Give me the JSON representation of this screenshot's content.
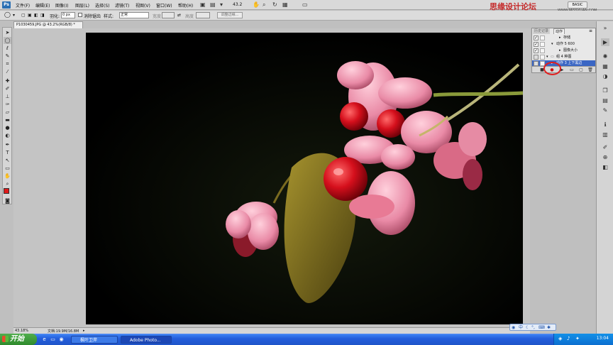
{
  "menubar": {
    "logo": "Ps",
    "items": [
      "文件(F)",
      "编辑(E)",
      "图像(I)",
      "图层(L)",
      "选择(S)",
      "滤镜(T)",
      "视图(V)",
      "窗口(W)",
      "帮助(H)"
    ],
    "zoom": "43.2",
    "workspace": "BASIC"
  },
  "watermark": {
    "text": "思缘设计论坛",
    "url": "WWW.MISSYUAN.COM"
  },
  "options": {
    "feather_label": "羽化:",
    "feather_value": "0 px",
    "antialias_label": "消除锯齿",
    "style_label": "样式:",
    "style_value": "正常",
    "width_label": "宽度",
    "height_label": "高度",
    "refine_edge": "调整边缘..."
  },
  "document": {
    "tab_title": "P1030459.JPG @ 43.2%(RGB/8) *",
    "zoom_status": "43.18%",
    "doc_size": "文档:19.9M/16.8M"
  },
  "actions_panel": {
    "tabs": [
      "历史记录",
      "动作"
    ],
    "rows": [
      {
        "label": "存储",
        "checked": true
      },
      {
        "label": "动作 5  600",
        "checked": true
      },
      {
        "label": "图像大小",
        "checked": true
      },
      {
        "label": "组 4  种图",
        "checked": false
      },
      {
        "label": "动作 3  上下黑边",
        "checked": false
      }
    ]
  },
  "taskbar": {
    "start": "开始",
    "windows": [
      "枫叶卫斧",
      "Adobe Photo..."
    ],
    "clock": "13:04"
  },
  "colors": {
    "accent": "#2a6fb3",
    "taskbar": "#245edb",
    "start": "#3a9a37",
    "highlight_circle": "#e02020",
    "selected_row": "#3a66c4"
  }
}
